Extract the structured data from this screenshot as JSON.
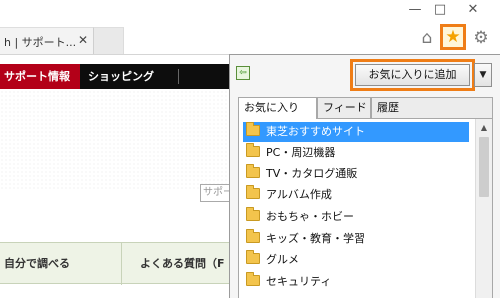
{
  "window": {
    "minimize_glyph": "—",
    "maximize_glyph": "□",
    "close_glyph": "✕"
  },
  "tab": {
    "title": "h | サポート...",
    "close_glyph": "✕"
  },
  "toolbar": {
    "home_glyph": "⌂",
    "favorites_glyph": "★",
    "tools_glyph": "⚙",
    "accent_color": "#ef7d16"
  },
  "site": {
    "nav": [
      "サポート情報",
      "ショッピング"
    ],
    "search_placeholder": "サポー",
    "bottom_nav": [
      "自分で調べる",
      "よくある質問（F"
    ],
    "brand_color": "#b30018"
  },
  "favorites_panel": {
    "pin_glyph": "⇦",
    "add_button_label": "お気に入りに追加",
    "dropdown_glyph": "▼",
    "tabs": [
      "お気に入り",
      "フィード",
      "履歴"
    ],
    "active_tab": "お気に入り",
    "items": [
      {
        "label": "東芝おすすめサイト",
        "selected": true
      },
      {
        "label": "PC・周辺機器",
        "selected": false
      },
      {
        "label": "TV・カタログ通販",
        "selected": false
      },
      {
        "label": "アルバム作成",
        "selected": false
      },
      {
        "label": "おもちゃ・ホビー",
        "selected": false
      },
      {
        "label": "キッズ・教育・学習",
        "selected": false
      },
      {
        "label": "グルメ",
        "selected": false
      },
      {
        "label": "セキュリティ",
        "selected": false
      }
    ],
    "scroll_up_glyph": "▲",
    "selection_color": "#3399ff"
  }
}
